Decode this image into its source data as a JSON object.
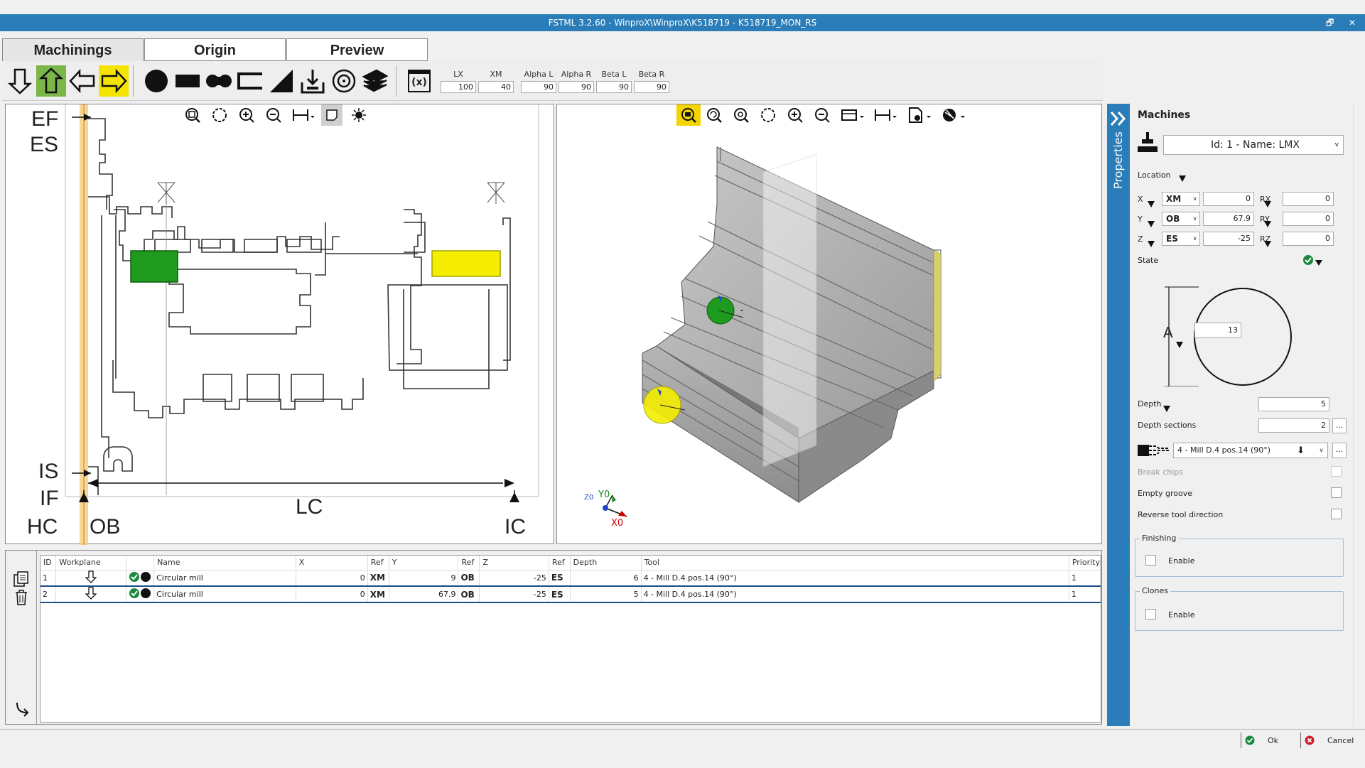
{
  "window": {
    "title": "FSTML 3.2.60 - WinproX\\WinproX\\K518719 - K518719_MON_RS",
    "restore_glyph": "🗗",
    "close_glyph": "✕"
  },
  "tabs": [
    {
      "label": "Machinings"
    },
    {
      "label": "Origin"
    },
    {
      "label": "Preview"
    }
  ],
  "toolbar": {
    "formula_label": "(x)",
    "dims": [
      {
        "label": "LX",
        "value": "100"
      },
      {
        "label": "XM",
        "value": "40"
      },
      {
        "label": "Alpha L",
        "value": "90"
      },
      {
        "label": "Alpha R",
        "value": "90"
      },
      {
        "label": "Beta L",
        "value": "90"
      },
      {
        "label": "Beta R",
        "value": "90"
      }
    ]
  },
  "view2d": {
    "labels": {
      "ef": "EF",
      "es": "ES",
      "is": "IS",
      "if": "IF",
      "hc": "HC",
      "ob": "OB",
      "lc": "LC",
      "ic": "IC"
    }
  },
  "view3d": {
    "axis_y": "Y0",
    "axis_x": "X0",
    "axis_z": "Z0"
  },
  "grid": {
    "columns": [
      "ID",
      "Workplane",
      "",
      "Name",
      "X",
      "Ref",
      "Y",
      "Ref",
      "Z",
      "Ref",
      "Depth",
      "Tool",
      "Priority"
    ],
    "rows": [
      {
        "id": "1",
        "name": "Circular mill",
        "x": "0",
        "xref": "XM",
        "y": "9",
        "yref": "OB",
        "z": "-25",
        "zref": "ES",
        "depth": "6",
        "tool": "4 - Mill D.4 pos.14 (90°)",
        "priority": "1"
      },
      {
        "id": "2",
        "name": "Circular mill",
        "x": "0",
        "xref": "XM",
        "y": "67.9",
        "yref": "OB",
        "z": "-25",
        "zref": "ES",
        "depth": "5",
        "tool": "4 - Mill D.4 pos.14 (90°)",
        "priority": "1"
      }
    ]
  },
  "properties": {
    "strip_label": "Properties",
    "title": "Machines",
    "machine": "Id: 1 - Name: LMX",
    "location_label": "Location",
    "x": {
      "label": "X",
      "ref": "XM",
      "value": "0",
      "rlabel": "RX",
      "rvalue": "0"
    },
    "y": {
      "label": "Y",
      "ref": "OB",
      "value": "67.9",
      "rlabel": "RY",
      "rvalue": "0"
    },
    "z": {
      "label": "Z",
      "ref": "ES",
      "value": "-25",
      "rlabel": "RZ",
      "rvalue": "0"
    },
    "state_label": "State",
    "diameter_label": "A",
    "diameter_value": "13",
    "depth_label": "Depth",
    "depth_value": "5",
    "depth_sections_label": "Depth sections",
    "depth_sections_value": "2",
    "tool": "4 - Mill D.4 pos.14 (90°)",
    "ellipsis": "...",
    "break_chips": "Break chips",
    "empty_groove": "Empty groove",
    "reverse_tool": "Reverse tool direction",
    "finishing_title": "Finishing",
    "finishing_enable": "Enable",
    "clones_title": "Clones",
    "clones_enable": "Enable"
  },
  "footer": {
    "ok": "Ok",
    "cancel": "Cancel"
  },
  "colors": {
    "accent": "#2a7db8",
    "green_mark": "#1f9a1f",
    "yellow_mark": "#f5e400",
    "active_green": "#7ab648"
  }
}
